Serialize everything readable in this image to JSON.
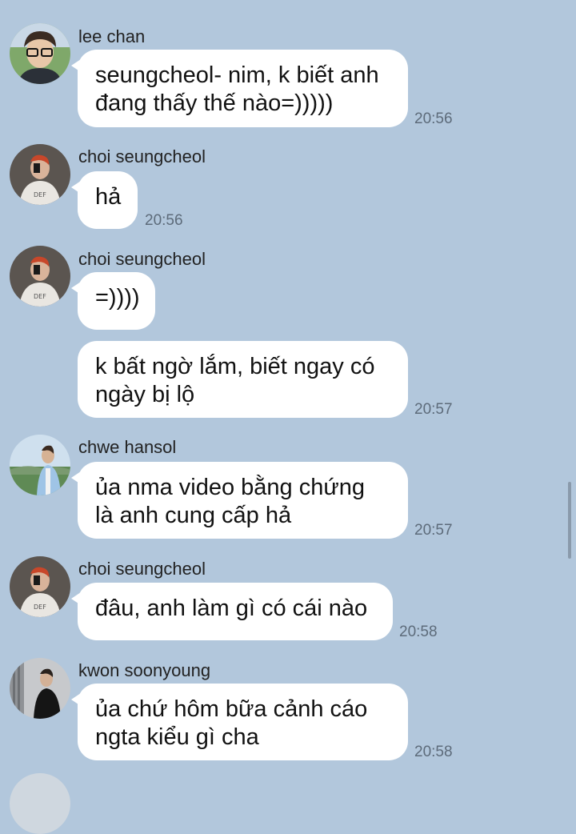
{
  "messages": [
    {
      "name": "lee chan",
      "text": [
        "seungcheol- nim, k biết anh",
        "đang thấy thế nào=)))))"
      ],
      "time": "20:56"
    },
    {
      "name": "choi seungcheol",
      "text": [
        "hả"
      ],
      "time": "20:56"
    },
    {
      "name": "choi seungcheol",
      "text": [
        "=))))"
      ],
      "time": ""
    },
    {
      "name": "",
      "text": [
        "k bất ngờ lắm, biết ngay có",
        "ngày bị lộ"
      ],
      "time": "20:57"
    },
    {
      "name": "chwe hansol",
      "text": [
        "ủa nma video bằng chứng",
        "là anh cung cấp hả"
      ],
      "time": "20:57"
    },
    {
      "name": "choi seungcheol",
      "text": [
        "đâu, anh làm gì có cái nào"
      ],
      "time": "20:58"
    },
    {
      "name": "kwon soonyoung",
      "text": [
        "ủa chứ hôm bữa cảnh cáo",
        "ngta kiểu gì cha"
      ],
      "time": "20:58"
    }
  ],
  "colors": {
    "background": "#b2c7dc",
    "bubble": "#ffffff",
    "time": "#5d6b7a"
  },
  "icons": [
    "avatar-lee-chan",
    "avatar-choi-seungcheol",
    "avatar-chwe-hansol",
    "avatar-kwon-soonyoung"
  ]
}
